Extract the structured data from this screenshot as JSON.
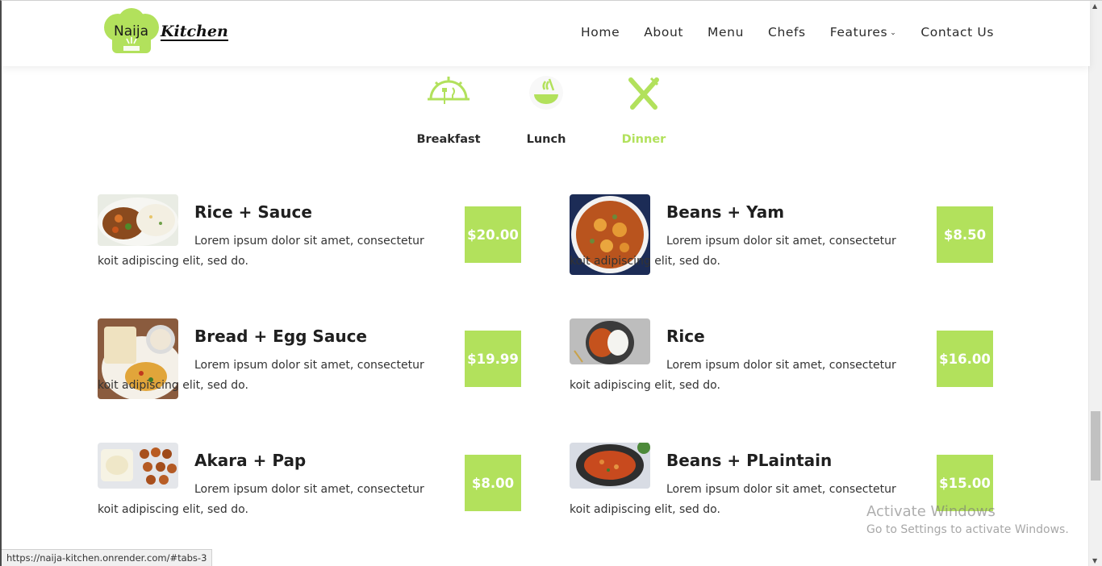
{
  "header": {
    "logo_word1": "Naija",
    "logo_word2": "Kitchen",
    "nav": [
      {
        "label": "Home"
      },
      {
        "label": "About"
      },
      {
        "label": "Menu"
      },
      {
        "label": "Chefs"
      },
      {
        "label": "Features",
        "icon": "chevron-down-icon"
      },
      {
        "label": "Contact Us"
      }
    ]
  },
  "tabs": [
    {
      "label": "Breakfast",
      "icon": "sunrise-dish-icon",
      "active": false
    },
    {
      "label": "Lunch",
      "icon": "bowl-icon",
      "active": false
    },
    {
      "label": "Dinner",
      "icon": "fork-knife-icon",
      "active": true
    }
  ],
  "menu_items": [
    {
      "title": "Rice + Sauce",
      "desc": "Lorem ipsum dolor sit amet, consectetur koit adipiscing elit, sed do.",
      "price": "$20.00"
    },
    {
      "title": "Beans + Yam",
      "desc": "Lorem ipsum dolor sit amet, consectetur koit adipiscing elit, sed do.",
      "price": "$8.50"
    },
    {
      "title": "Bread + Egg Sauce",
      "desc": "Lorem ipsum dolor sit amet, consectetur koit adipiscing elit, sed do.",
      "price": "$19.99"
    },
    {
      "title": "Rice",
      "desc": "Lorem ipsum dolor sit amet, consectetur koit adipiscing elit, sed do.",
      "price": "$16.00"
    },
    {
      "title": "Akara + Pap",
      "desc": "Lorem ipsum dolor sit amet, consectetur koit adipiscing elit, sed do.",
      "price": "$8.00"
    },
    {
      "title": "Beans + PLaintain",
      "desc": "Lorem ipsum dolor sit amet, consectetur koit adipiscing elit, sed do.",
      "price": "$15.00"
    }
  ],
  "colors": {
    "accent": "#b2e15c",
    "text": "#212529"
  },
  "status_url": "https://naija-kitchen.onrender.com/#tabs-3",
  "watermark": {
    "title": "Activate Windows",
    "subtitle": "Go to Settings to activate Windows."
  }
}
